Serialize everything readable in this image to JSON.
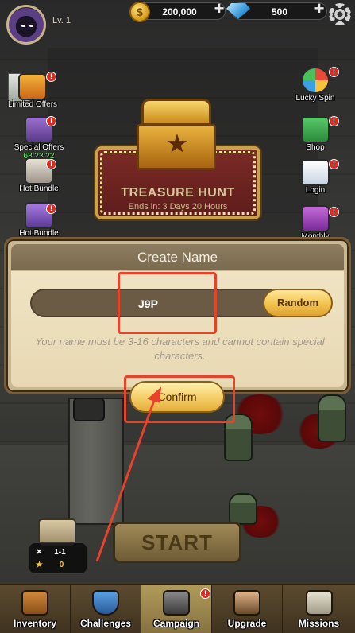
{
  "player": {
    "level_label": "Lv. 1"
  },
  "currency": {
    "coins": {
      "icon": "coin-icon",
      "symbol": "$",
      "value": "200,000"
    },
    "gems": {
      "icon": "gem-icon",
      "value": "500"
    }
  },
  "left_side": [
    {
      "label": "Limited Offers",
      "icon": "gift-icon",
      "badge": "!"
    },
    {
      "label": "Special Offers",
      "timer": "68:23:22",
      "icon": "chest-icon",
      "badge": "!"
    },
    {
      "label": "Hot Bundle",
      "icon": "hero-icon",
      "badge": "!"
    },
    {
      "label": "Hot Bundle",
      "icon": "hero-purple-icon",
      "badge": "!"
    }
  ],
  "right_side": [
    {
      "label": "Lucky Spin",
      "icon": "wheel-icon",
      "badge": "!"
    },
    {
      "label": "Shop",
      "icon": "cart-icon",
      "badge": "!"
    },
    {
      "label": "Login",
      "icon": "calendar-icon",
      "badge": "!"
    },
    {
      "label": "Monthly",
      "icon": "book-icon",
      "badge": "!"
    }
  ],
  "treasure_hunt": {
    "title": "TREASURE HUNT",
    "subtitle": "Ends in: 3 Days 20 Hours"
  },
  "dialog": {
    "title": "Create Name",
    "name_value": "J9P",
    "random_label": "Random",
    "hint": "Your name must be 3-16 characters and cannot contain special characters.",
    "confirm_label": "Confirm"
  },
  "stage": {
    "stage_label": "1-1",
    "stars": "0"
  },
  "start_label": "START",
  "tabs": [
    {
      "label": "Inventory",
      "icon": "backpack-icon"
    },
    {
      "label": "Challenges",
      "icon": "shield-icon"
    },
    {
      "label": "Campaign",
      "icon": "crossed-guns-icon",
      "badge": "!"
    },
    {
      "label": "Upgrade",
      "icon": "soldier-icon"
    },
    {
      "label": "Missions",
      "icon": "clipboard-icon"
    }
  ],
  "colors": {
    "highlight": "#e8422b",
    "timer_green": "#5fff5f",
    "badge_red": "#e0281e",
    "button_gold": "#f2c24c"
  }
}
